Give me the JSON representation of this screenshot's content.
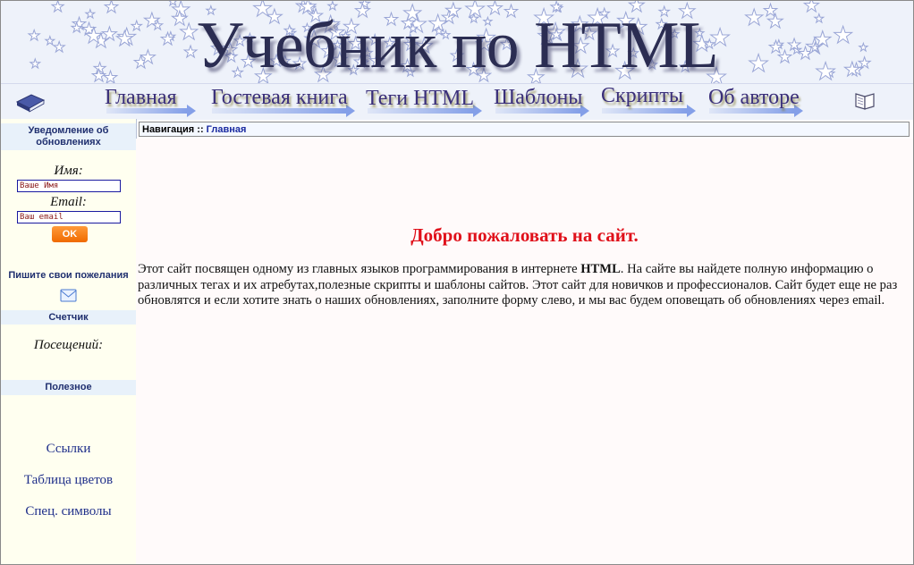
{
  "banner": {
    "title": "Учебник по HTML"
  },
  "nav": {
    "items": [
      {
        "label": "Главная"
      },
      {
        "label": "Гостевая книга"
      },
      {
        "label": "Теги HTML"
      },
      {
        "label": "Шаблоны"
      },
      {
        "label": "Скрипты"
      },
      {
        "label": "Об авторе"
      }
    ]
  },
  "sidebar": {
    "subscribe_header": "Уведомление об обновлениях",
    "name_label": "Имя:",
    "name_value": "Ваше Имя",
    "email_label": "Email:",
    "email_value": "Ваш email",
    "ok_label": "OK",
    "wishes_header": "Пишите свои пожелания",
    "counter_header": "Счетчик",
    "visits_label": "Посещений:",
    "useful_header": "Полезное",
    "links": [
      {
        "label": "Ссылки"
      },
      {
        "label": "Таблица цветов"
      },
      {
        "label": "Спец. символы"
      }
    ]
  },
  "breadcrumb": {
    "prefix": "Навигация :: ",
    "current": "Главная"
  },
  "main": {
    "welcome": "Добро пожаловать на сайт.",
    "intro_before": "Этот сайт посвящен одному из главных языков программирования в интернете ",
    "intro_bold": "HTML",
    "intro_after": ". На сайте вы найдете полную информацию о различных тегах и их атребутах,полезные скрипты и шаблоны сайтов. Этот сайт для новичков и профессионалов. Сайт будет еще не раз обновлятся и если хотите знать о наших обновлениях, заполните форму слево, и мы вас будем оповещать об обновлениях через email."
  },
  "colors": {
    "title": "#2b2d52",
    "nav_text": "#3a2f7a",
    "welcome": "#e0101a",
    "ok_button": "#f57a12",
    "sidebar_bg": "#fffff0",
    "link": "#1f2f8a"
  }
}
